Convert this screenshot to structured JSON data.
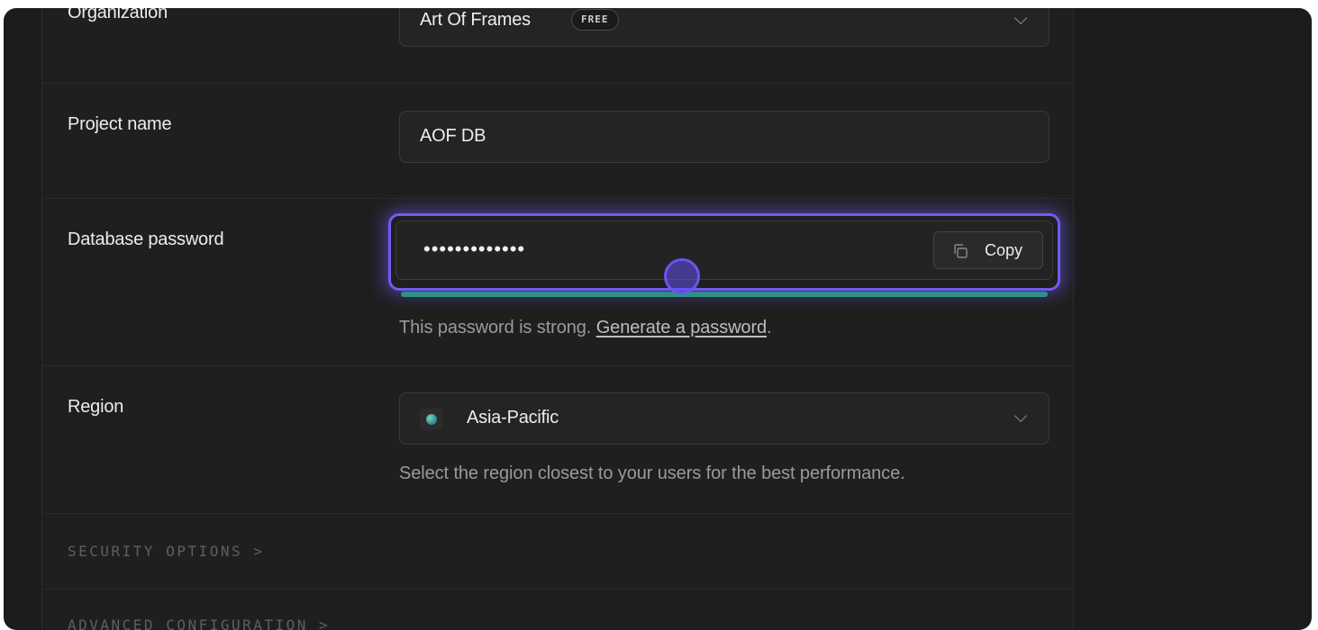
{
  "form": {
    "organization": {
      "label": "Organization",
      "value": "Art Of Frames",
      "badge": "FREE"
    },
    "project_name": {
      "label": "Project name",
      "value": "AOF DB"
    },
    "database_password": {
      "label": "Database password",
      "masked_value": "•••••••••••••",
      "copy_label": "Copy",
      "help_prefix": "This password is strong.",
      "help_link": "Generate a password",
      "help_suffix": ".",
      "strength_fraction": 1.0,
      "strength_color": "#2e8f88"
    },
    "region": {
      "label": "Region",
      "value": "Asia-Pacific",
      "help": "Select the region closest to your users for the best performance."
    },
    "sections": {
      "security": "SECURITY OPTIONS >",
      "advanced": "ADVANCED CONFIGURATION >"
    }
  },
  "colors": {
    "focus_accent": "#6f5cf0",
    "background": "#1c1c1c"
  }
}
